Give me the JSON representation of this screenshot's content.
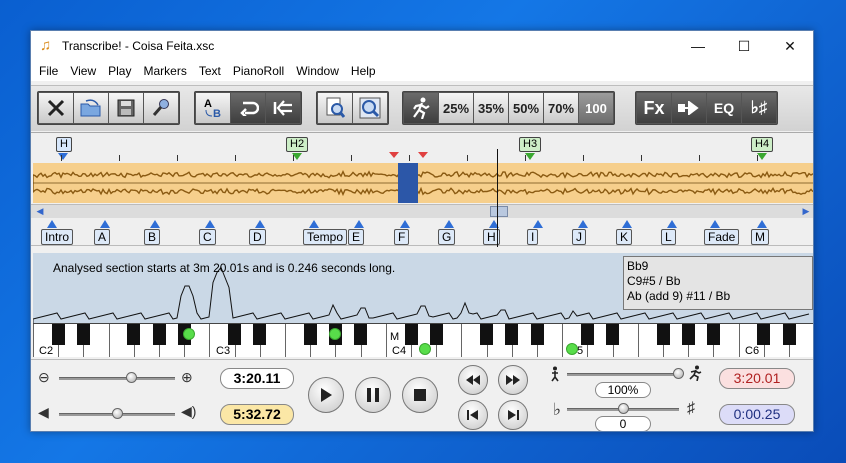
{
  "window": {
    "title": "Transcribe! - Coisa Feita.xsc",
    "minimize": "—",
    "maximize": "☐",
    "close": "✕"
  },
  "menu": [
    "File",
    "View",
    "Play",
    "Markers",
    "Text",
    "PianoRoll",
    "Window",
    "Help"
  ],
  "toolbar": {
    "speeds": [
      "25%",
      "35%",
      "50%",
      "70%",
      "100"
    ],
    "fx_label": "Fx",
    "eq_label": "EQ",
    "selected_speed": "100"
  },
  "markers_top": [
    {
      "label": "H",
      "color": "blue"
    },
    {
      "label": "H2",
      "color": "green"
    },
    {
      "label": "H3",
      "color": "green"
    },
    {
      "label": "H4",
      "color": "green"
    }
  ],
  "sections": [
    "Intro",
    "A",
    "B",
    "C",
    "D",
    "Tempo",
    "E",
    "F",
    "G",
    "H",
    "I",
    "J",
    "K",
    "L",
    "Fade",
    "M"
  ],
  "analysis": {
    "message": "Analysed section starts at 3m 20.01s and is 0.246 seconds long.",
    "chords": [
      "Bb9",
      "C9#5 / Bb",
      "Ab (add 9) #11 / Bb"
    ]
  },
  "piano": {
    "labels": [
      "C2",
      "C3",
      "C4",
      "C5",
      "C6"
    ],
    "middle_marker": "M"
  },
  "controls": {
    "position_time": "3:20.11",
    "length_time": "5:32.72",
    "speed_percent": "100%",
    "pitch_value": "0",
    "loop_start": "3:20.01",
    "loop_length": "0:00.25",
    "speed_slider": 1.0,
    "volume_slider": 0.5,
    "zoom_slider": 0.55,
    "pitch_slider": 0.5
  },
  "colors": {
    "waveform_bg": "#f6cf8c",
    "waveform_fg": "#8a5a12",
    "selection": "#2c57a8",
    "analysis_bg": "#cad8e6",
    "note_dot": "#58dd4a",
    "loop_start_bg": "#fbe0e0",
    "length_bg": "#fbe7a6",
    "loop_len_bg": "#dcdcf8"
  }
}
